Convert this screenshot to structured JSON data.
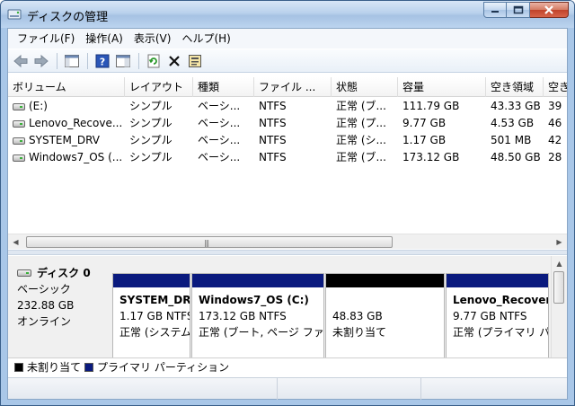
{
  "window": {
    "title": "ディスクの管理",
    "accent": "#a9c7e8"
  },
  "menu": [
    "ファイル(F)",
    "操作(A)",
    "表示(V)",
    "ヘルプ(H)"
  ],
  "toolbar": {
    "buttons": [
      "back-arrow-icon",
      "forward-arrow-icon",
      "console-tree-icon",
      "help-icon",
      "properties-icon",
      "refresh-icon",
      "delete-icon",
      "properties-pane-icon"
    ]
  },
  "volume_list": {
    "columns": [
      "ボリューム",
      "レイアウト",
      "種類",
      "ファイル ...",
      "状態",
      "容量",
      "空き領域",
      "空き"
    ],
    "rows": [
      [
        "(E:)",
        "シンプル",
        "ベーシ...",
        "NTFS",
        "正常 (ブ...",
        "111.79 GB",
        "43.33 GB",
        "39"
      ],
      [
        "Lenovo_Recove...",
        "シンプル",
        "ベーシ...",
        "NTFS",
        "正常 (プ...",
        "9.77 GB",
        "4.53 GB",
        "46"
      ],
      [
        "SYSTEM_DRV",
        "シンプル",
        "ベーシ...",
        "NTFS",
        "正常 (シ...",
        "1.17 GB",
        "501 MB",
        "42"
      ],
      [
        "Windows7_OS (...",
        "シンプル",
        "ベーシ...",
        "NTFS",
        "正常 (ブ...",
        "173.12 GB",
        "48.50 GB",
        "28"
      ]
    ]
  },
  "disk": {
    "name": "ディスク 0",
    "type": "ベーシック",
    "size": "232.88 GB",
    "status": "オンライン"
  },
  "partitions": [
    {
      "title": "SYSTEM_DRV",
      "size_fs": "1.17 GB NTFS",
      "status": "正常 (システム",
      "bar_color": "#0a1a7e"
    },
    {
      "title": "Windows7_OS  (C:)",
      "size_fs": "173.12 GB NTFS",
      "status": "正常 (ブート, ページ ファイ",
      "bar_color": "#0a1a7e"
    },
    {
      "title": "",
      "size_fs": "48.83 GB",
      "status": "未割り当て",
      "bar_color": "#000000"
    },
    {
      "title": "Lenovo_Recovery",
      "size_fs": "9.77 GB NTFS",
      "status": "正常 (プライマリ パ",
      "bar_color": "#0a1a7e"
    }
  ],
  "legend": [
    {
      "label": "未割り当て",
      "color": "#000000"
    },
    {
      "label": "プライマリ パーティション",
      "color": "#0a1a7e"
    }
  ]
}
